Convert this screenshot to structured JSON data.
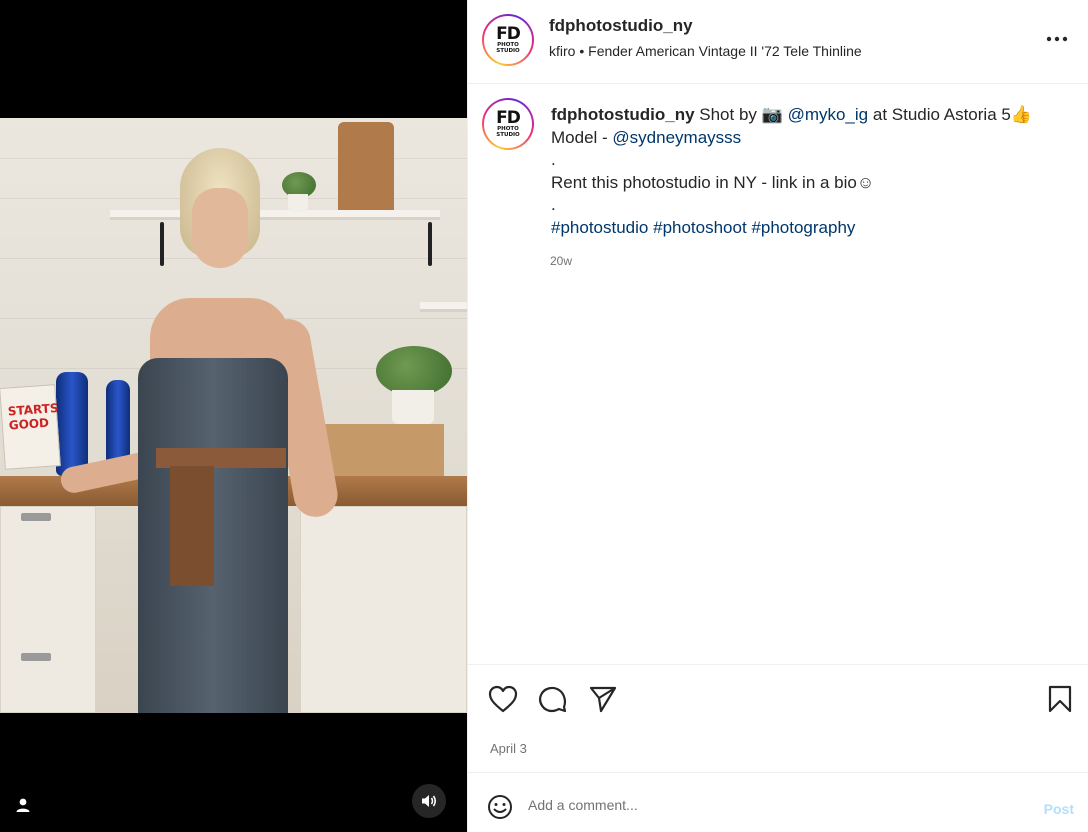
{
  "post": {
    "username": "fdphotostudio_ny",
    "audio_artist": "kfiro",
    "audio_separator": "•",
    "audio_track": "Fender American Vintage II '72 Tele Thinline",
    "avatar_logo": "FD",
    "avatar_sub": "PHOTO STUDIO"
  },
  "media": {
    "book_text": "STARTS\nGOOD",
    "sound_icon": "speaker-icon",
    "user_icon": "person-icon"
  },
  "caption": {
    "username": "fdphotostudio_ny",
    "text_1": "Shot by",
    "camera_emoji": "📷",
    "mention_1": "@myko_ig",
    "text_2": "at Studio Astoria 5",
    "thumb_emoji": "👍",
    "text_3": "Model -",
    "mention_2": "@sydneymaysss",
    "dot_1": ".",
    "line_rent": "Rent this photostudio in NY - link in a bio",
    "smile_emoji": "☺",
    "dot_2": ".",
    "hashtag_1": "#photostudio",
    "hashtag_2": "#photoshoot",
    "hashtag_3": "#photography",
    "time": "20w"
  },
  "actions": {
    "date": "April 3"
  },
  "comment": {
    "placeholder": "Add a comment...",
    "post_label": "Post"
  },
  "colors": {
    "link": "#00376b",
    "muted": "#737373",
    "post_disabled": "#b2dffc"
  }
}
